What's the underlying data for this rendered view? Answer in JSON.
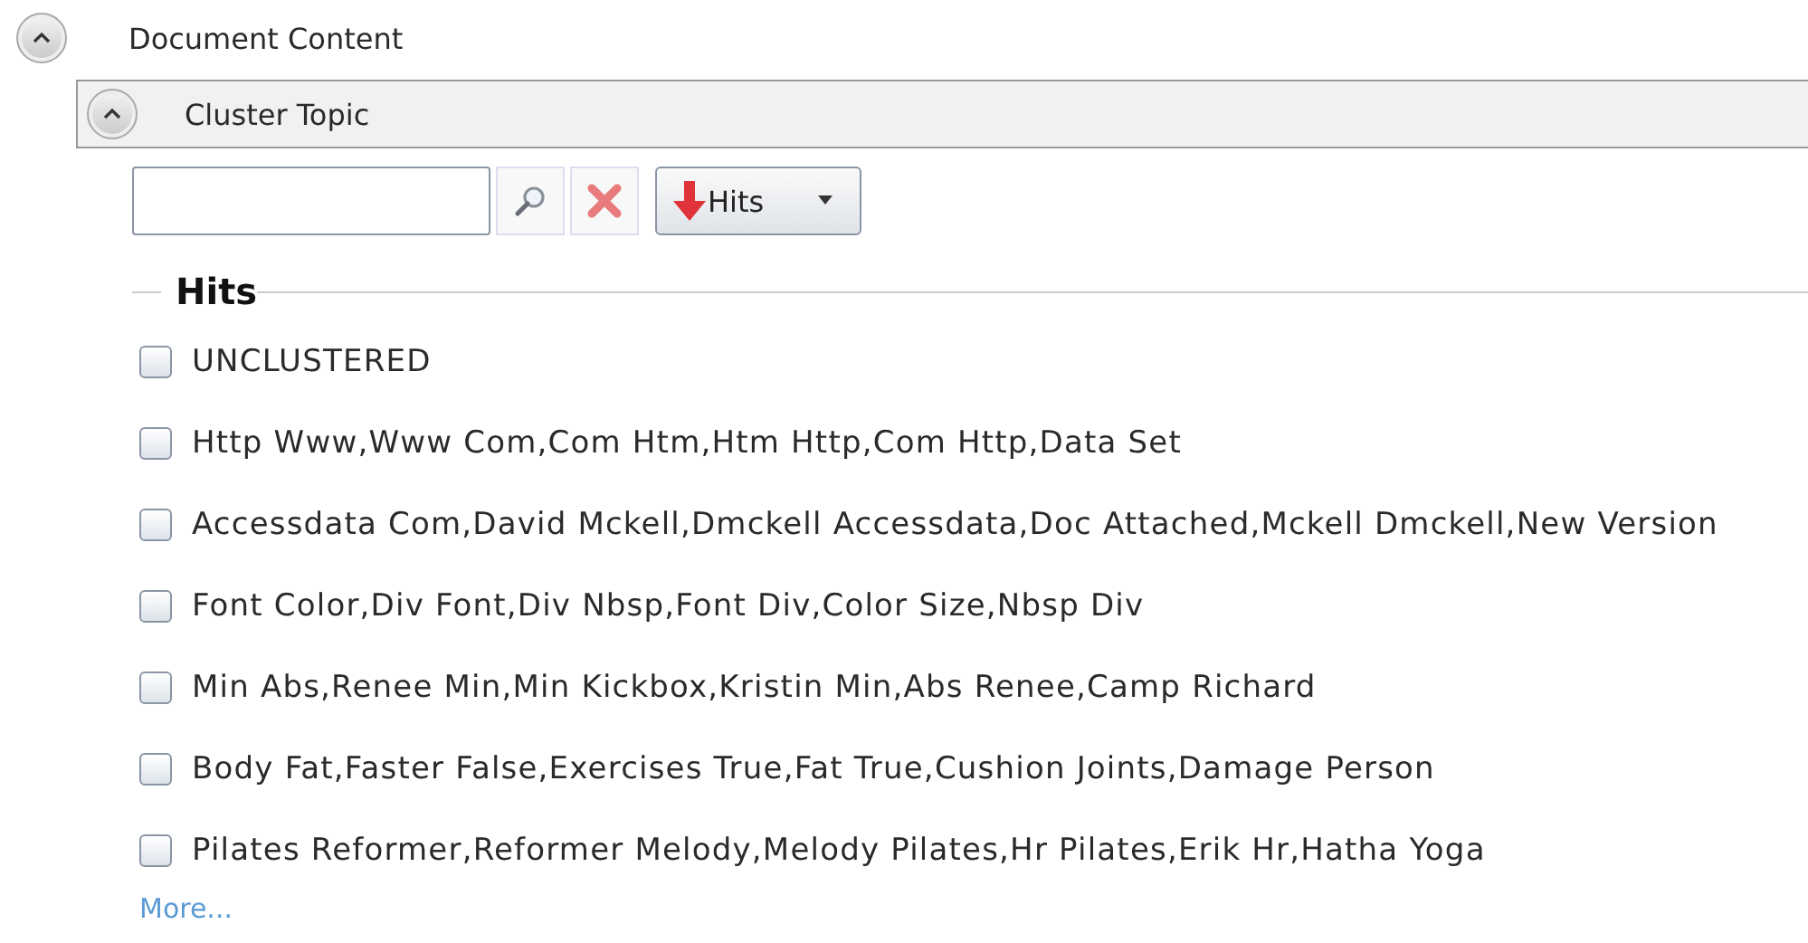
{
  "section": {
    "title": "Document Content",
    "expanded": true
  },
  "panel": {
    "title": "Cluster Topic",
    "expanded": true
  },
  "toolbar": {
    "sort_button": {
      "label": "Hits"
    }
  },
  "list": {
    "heading": "Hits",
    "items": [
      {
        "label": "UNCLUSTERED",
        "checked": false
      },
      {
        "label": "Http Www,Www Com,Com Htm,Htm Http,Com Http,Data Set",
        "checked": false
      },
      {
        "label": "Accessdata Com,David Mckell,Dmckell Accessdata,Doc Attached,Mckell Dmckell,New Version",
        "checked": false
      },
      {
        "label": "Font Color,Div Font,Div Nbsp,Font Div,Color Size,Nbsp Div",
        "checked": false
      },
      {
        "label": "Min Abs,Renee Min,Min Kickbox,Kristin Min,Abs Renee,Camp Richard",
        "checked": false
      },
      {
        "label": "Body Fat,Faster False,Exercises True,Fat True,Cushion Joints,Damage Person",
        "checked": false
      },
      {
        "label": "Pilates Reformer,Reformer Melody,Melody Pilates,Hr Pilates,Erik Hr,Hatha Yoga",
        "checked": false
      }
    ],
    "more_link": "More..."
  }
}
